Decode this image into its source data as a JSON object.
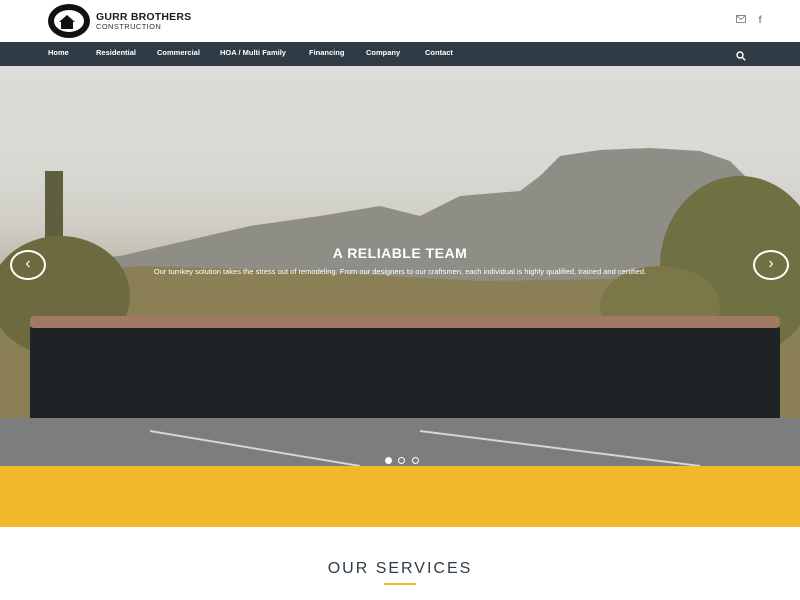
{
  "header": {
    "brand_name": "GURR BROTHERS",
    "brand_sub": "CONSTRUCTION",
    "icons": [
      "mail-icon",
      "facebook-icon"
    ]
  },
  "nav": {
    "items": [
      "Home",
      "Residential",
      "Commercial",
      "HOA / Multi Family",
      "Financing",
      "Company",
      "Contact"
    ],
    "search_icon": "search-icon"
  },
  "hero": {
    "title": "A RELIABLE TEAM",
    "subtitle": "Our turnkey solution takes the stress out of remodeling. From our designers to our craftsmen, each individual is highly qualified, trained and certified.",
    "prev_icon": "chevron-left-icon",
    "next_icon": "chevron-right-icon",
    "slides_total": 3,
    "active_slide": 1
  },
  "services": {
    "title": "OUR SERVICES"
  },
  "colors": {
    "nav_bg": "#2f3b44",
    "accent": "#f1b82c",
    "text_dark": "#2f3b44"
  }
}
